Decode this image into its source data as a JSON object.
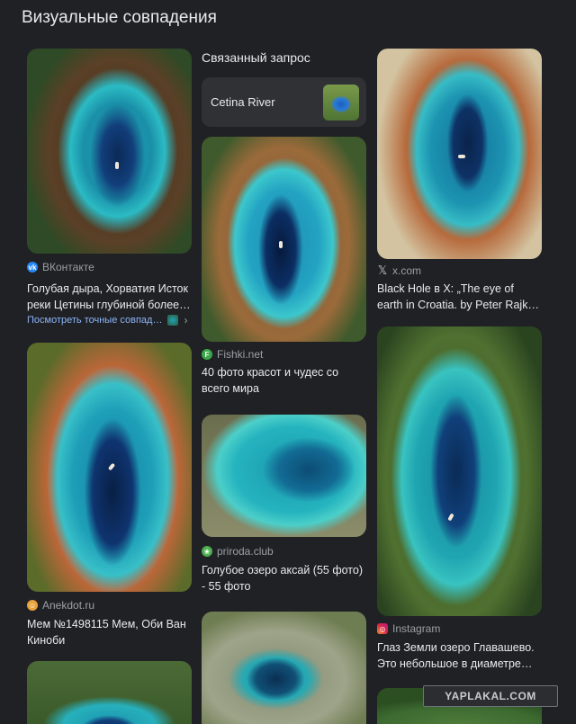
{
  "header": {
    "title": "Визуальные совпадения"
  },
  "related": {
    "heading": "Связанный запрос",
    "chip_label": "Cetina River"
  },
  "results": [
    {
      "source": "ВКонтакте",
      "source_icon": "vk-icon",
      "caption_line1": "Голубая дыра, Хорватия Исток",
      "caption_line2": "реки Цетины глубиной более…",
      "link": "Посмотреть точные совпад…"
    },
    {
      "source": "Anekdot.ru",
      "source_icon": "anekdot-icon",
      "caption_line1": "Мем №1498115 Мем, Оби Ван",
      "caption_line2": "Киноби"
    },
    {
      "source": "Fishki.net",
      "source_icon": "fishki-icon",
      "caption_line1": "40 фото красот и чудес со",
      "caption_line2": "всего мира"
    },
    {
      "source": "priroda.club",
      "source_icon": "priroda-icon",
      "caption_line1": "Голубое озеро аксай (55 фото)",
      "caption_line2": "- 55 фото"
    },
    {
      "source": "x.com",
      "source_icon": "x-icon",
      "caption_line1": "Black Hole в X: „The eye of",
      "caption_line2": "earth in Croatia. by Peter Rajk…"
    },
    {
      "source": "Instagram",
      "source_icon": "instagram-icon",
      "caption_line1": "Глаз Земли озеро Главашево.",
      "caption_line2": "Это небольшое в диаметре…"
    }
  ],
  "watermark": "YAPLAKAL.COM",
  "colors": {
    "background": "#202124",
    "text": "#e8eaed",
    "muted": "#9aa0a6",
    "link": "#8ab4f8",
    "chip": "#303134"
  }
}
